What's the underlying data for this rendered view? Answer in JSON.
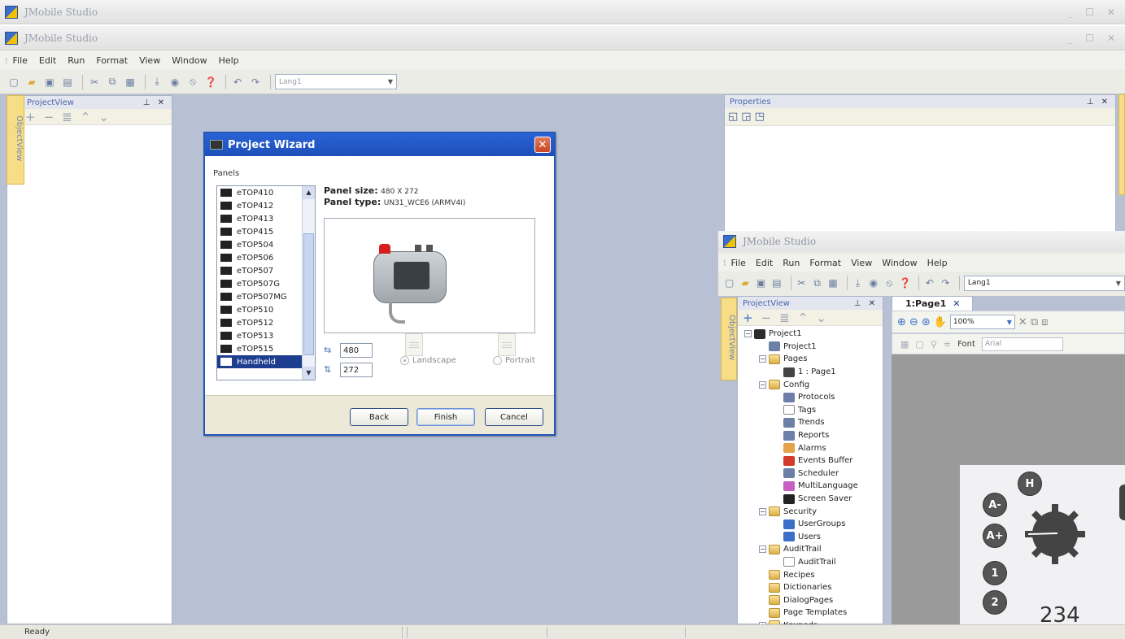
{
  "app": {
    "title": "JMobile Studio",
    "window_controls": "_ ☐ ✕"
  },
  "menu": [
    "File",
    "Edit",
    "Run",
    "Format",
    "View",
    "Window",
    "Help"
  ],
  "toolbar": {
    "language": "Lang1"
  },
  "project_view": {
    "title": "ProjectView",
    "object_view_tab": "ObjectView"
  },
  "dialog": {
    "title": "Project Wizard",
    "panels_label": "Panels",
    "panels": [
      "eTOP410",
      "eTOP412",
      "eTOP413",
      "eTOP415",
      "eTOP504",
      "eTOP506",
      "eTOP507",
      "eTOP507G",
      "eTOP507MG",
      "eTOP510",
      "eTOP512",
      "eTOP513",
      "eTOP515",
      "Handheld"
    ],
    "selected_panel": "Handheld",
    "panel_size_label": "Panel size:",
    "panel_size_value": "480 X 272",
    "panel_type_label": "Panel type:",
    "panel_type_value": "UN31_WCE6 (ARMV4I)",
    "width": "480",
    "height": "272",
    "orientation_landscape": "Landscape",
    "orientation_portrait": "Portrait",
    "back_button": "Back",
    "finish_button": "Finish",
    "cancel_button": "Cancel"
  },
  "properties": {
    "title": "Properties"
  },
  "inner_window": {
    "title": "JMobile Studio",
    "language": "Lang1",
    "project_view_title": "ProjectView",
    "object_view_tab": "ObjectView",
    "editor_tab": "1:Page1",
    "zoom": "100%",
    "font_label": "Font",
    "font_value": "Arial",
    "tree": [
      {
        "label": "Project1",
        "depth": 0,
        "icon": "proj",
        "expander": "-"
      },
      {
        "label": "Project1",
        "depth": 1,
        "icon": "tool",
        "expander": ""
      },
      {
        "label": "Pages",
        "depth": 1,
        "icon": "folder",
        "expander": "-"
      },
      {
        "label": "1 : Page1",
        "depth": 2,
        "icon": "page",
        "expander": ""
      },
      {
        "label": "Config",
        "depth": 1,
        "icon": "folder",
        "expander": "-"
      },
      {
        "label": "Protocols",
        "depth": 2,
        "icon": "tool",
        "expander": ""
      },
      {
        "label": "Tags",
        "depth": 2,
        "icon": "doc",
        "expander": ""
      },
      {
        "label": "Trends",
        "depth": 2,
        "icon": "tool",
        "expander": ""
      },
      {
        "label": "Reports",
        "depth": 2,
        "icon": "tool",
        "expander": ""
      },
      {
        "label": "Alarms",
        "depth": 2,
        "icon": "alarm",
        "expander": ""
      },
      {
        "label": "Events Buffer",
        "depth": 2,
        "icon": "event",
        "expander": ""
      },
      {
        "label": "Scheduler",
        "depth": 2,
        "icon": "tool",
        "expander": ""
      },
      {
        "label": "MultiLanguage",
        "depth": 2,
        "icon": "multi",
        "expander": ""
      },
      {
        "label": "Screen Saver",
        "depth": 2,
        "icon": "screen",
        "expander": ""
      },
      {
        "label": "Security",
        "depth": 1,
        "icon": "sec",
        "expander": "-"
      },
      {
        "label": "UserGroups",
        "depth": 2,
        "icon": "user",
        "expander": ""
      },
      {
        "label": "Users",
        "depth": 2,
        "icon": "user",
        "expander": ""
      },
      {
        "label": "AuditTrail",
        "depth": 1,
        "icon": "sec",
        "expander": "-"
      },
      {
        "label": "AuditTrail",
        "depth": 2,
        "icon": "doc",
        "expander": ""
      },
      {
        "label": "Recipes",
        "depth": 1,
        "icon": "folder",
        "expander": ""
      },
      {
        "label": "Dictionaries",
        "depth": 1,
        "icon": "folder",
        "expander": ""
      },
      {
        "label": "DialogPages",
        "depth": 1,
        "icon": "folder",
        "expander": ""
      },
      {
        "label": "Page Templates",
        "depth": 1,
        "icon": "folder",
        "expander": ""
      },
      {
        "label": "Keypads",
        "depth": 1,
        "icon": "folder",
        "expander": "+"
      }
    ],
    "canvas": {
      "buttons": [
        "H",
        "A-",
        "A+",
        "1",
        "2"
      ],
      "readout": "234"
    }
  },
  "status": {
    "text": "Ready"
  }
}
